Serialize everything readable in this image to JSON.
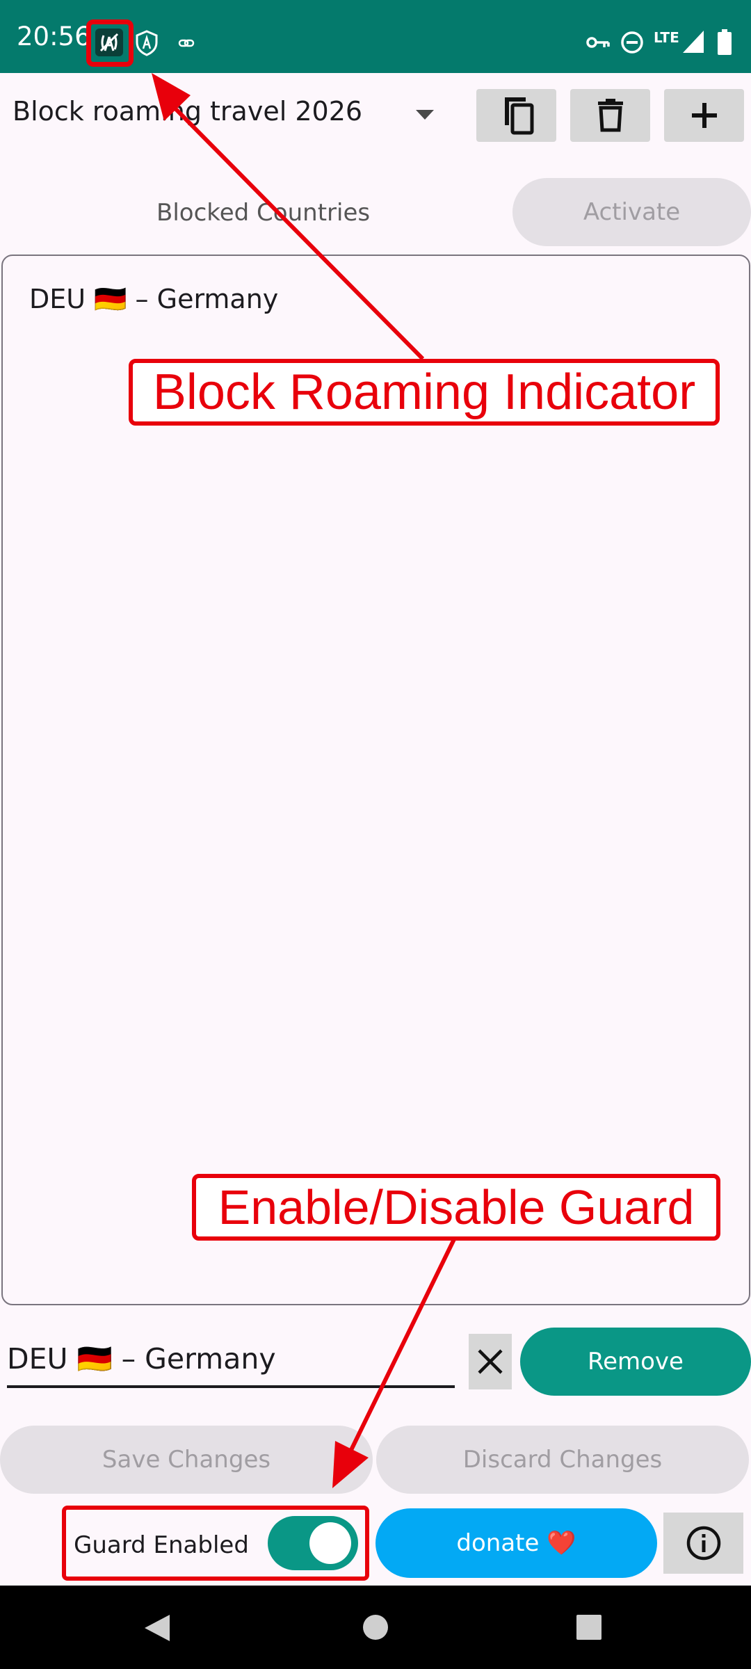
{
  "status_bar": {
    "time": "20:56",
    "network_label": "LTE",
    "icons": [
      "block-roaming-icon",
      "shield-a-icon",
      "link-icon",
      "vpn-key-icon",
      "do-not-disturb-icon",
      "signal-icon",
      "battery-icon"
    ]
  },
  "toolbar": {
    "profile_name": "Block roaming travel 2026",
    "buttons": [
      "copy-icon",
      "delete-icon",
      "add-icon"
    ]
  },
  "header": {
    "section_label": "Blocked Countries",
    "activate_label": "Activate"
  },
  "blocked_countries": [
    {
      "label": "DEU 🇩🇪 – Germany"
    }
  ],
  "country_input": {
    "value": "DEU 🇩🇪 – Germany",
    "remove_label": "Remove"
  },
  "actions": {
    "save_label": "Save Changes",
    "discard_label": "Discard Changes"
  },
  "footer": {
    "guard_label": "Guard Enabled",
    "guard_enabled": true,
    "donate_label": "donate ❤️"
  },
  "annotations": {
    "indicator_label": "Block Roaming Indicator",
    "guard_label": "Enable/Disable Guard"
  },
  "colors": {
    "status_bar": "#047a6c",
    "accent": "#0a9786",
    "donate": "#03a9f4",
    "annotation": "#e8000b"
  }
}
